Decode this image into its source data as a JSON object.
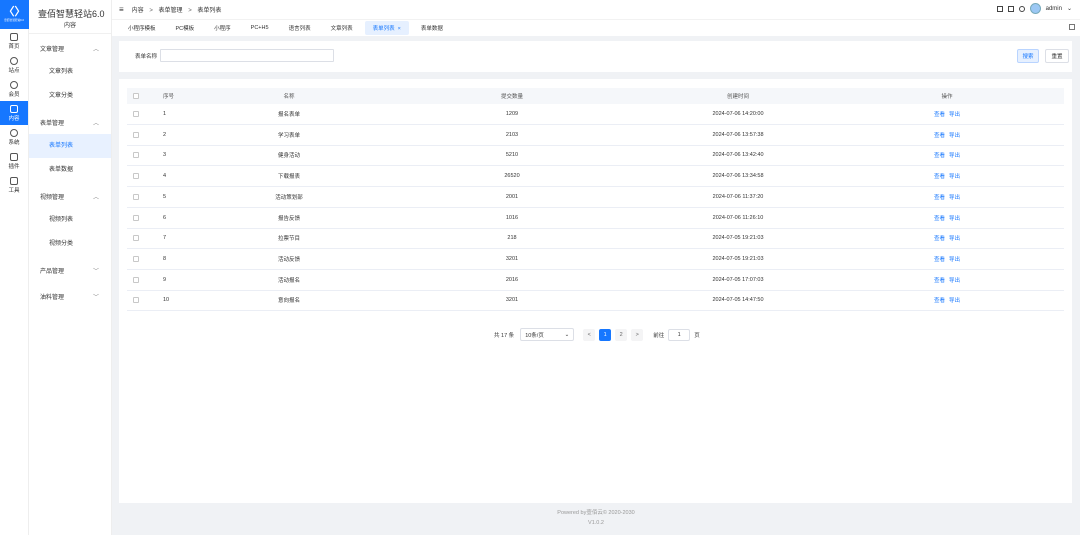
{
  "rail": {
    "logo_text": "壹佰智慧轻站6.0",
    "items": [
      {
        "label": "首页",
        "icon": "monitor-icon"
      },
      {
        "label": "站点",
        "icon": "globe-icon"
      },
      {
        "label": "会员",
        "icon": "user-icon"
      },
      {
        "label": "内容",
        "icon": "document-icon",
        "active": true
      },
      {
        "label": "系统",
        "icon": "gear-icon"
      },
      {
        "label": "插件",
        "icon": "plugin-icon"
      },
      {
        "label": "工具",
        "icon": "toolbox-icon"
      }
    ]
  },
  "sidebar": {
    "title": "壹佰智慧轻站6.0",
    "subtitle": "内容",
    "groups": [
      {
        "label": "文章管理",
        "expanded": true,
        "items": [
          "文章列表",
          "文章分类"
        ]
      },
      {
        "label": "表单管理",
        "expanded": true,
        "items": [
          "表单列表",
          "表单数据"
        ],
        "active_item": "表单列表"
      },
      {
        "label": "视频管理",
        "expanded": true,
        "items": [
          "视频列表",
          "视频分类"
        ]
      },
      {
        "label": "产品管理",
        "expanded": false,
        "items": []
      },
      {
        "label": "油料管理",
        "expanded": false,
        "items": []
      }
    ]
  },
  "header": {
    "breadcrumb": [
      "内容",
      "表单管理",
      "表单列表"
    ],
    "user": "admin"
  },
  "tabs": [
    {
      "label": "小程序模板"
    },
    {
      "label": "PC模板"
    },
    {
      "label": "小程序"
    },
    {
      "label": "PC+H5"
    },
    {
      "label": "语言列表"
    },
    {
      "label": "文章列表"
    },
    {
      "label": "表单列表",
      "active": true,
      "closable": true
    },
    {
      "label": "表单数据"
    }
  ],
  "search": {
    "label": "表单名称",
    "value": "",
    "placeholder": "",
    "search_button": "搜索",
    "reset_button": "重置"
  },
  "table": {
    "columns": [
      "序号",
      "名称",
      "提交数量",
      "创建时间",
      "操作"
    ],
    "rows": [
      {
        "no": "1",
        "name": "报名表单",
        "count": "1209",
        "time": "2024-07-06 14:20:00"
      },
      {
        "no": "2",
        "name": "学习表单",
        "count": "2103",
        "time": "2024-07-06 13:57:38"
      },
      {
        "no": "3",
        "name": "健身活动",
        "count": "5210",
        "time": "2024-07-06 13:42:40"
      },
      {
        "no": "4",
        "name": "下载报表",
        "count": "26520",
        "time": "2024-07-06 13:34:58"
      },
      {
        "no": "5",
        "name": "活动策划部",
        "count": "2001",
        "time": "2024-07-06 11:37:20"
      },
      {
        "no": "6",
        "name": "报告反馈",
        "count": "1016",
        "time": "2024-07-06 11:26:10"
      },
      {
        "no": "7",
        "name": "拉票节目",
        "count": "218",
        "time": "2024-07-05 19:21:03"
      },
      {
        "no": "8",
        "name": "活动反馈",
        "count": "3201",
        "time": "2024-07-05 19:21:03"
      },
      {
        "no": "9",
        "name": "活动报名",
        "count": "2016",
        "time": "2024-07-05 17:07:03"
      },
      {
        "no": "10",
        "name": "意向报名",
        "count": "3201",
        "time": "2024-07-05 14:47:50"
      }
    ],
    "action_view": "查看",
    "action_export": "导出"
  },
  "pagination": {
    "total": "共 17 条",
    "page_size": "10条/页",
    "prev": "<",
    "pages": [
      "1",
      "2"
    ],
    "current": "1",
    "next": ">",
    "goto_label": "前往",
    "goto_value": "1",
    "goto_suffix": "页"
  },
  "footer": {
    "powered": "Powered by壹佰云© 2020-2030",
    "version": "V1.0.2"
  }
}
